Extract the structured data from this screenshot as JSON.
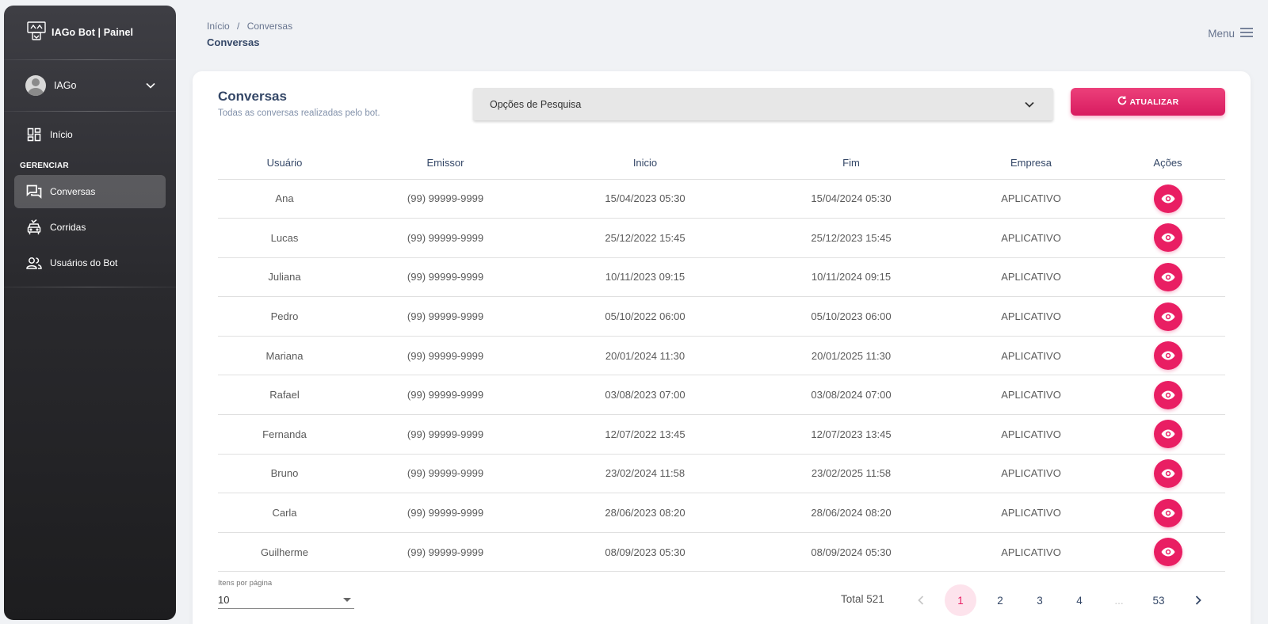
{
  "sidebar": {
    "brand": "IAGo Bot | Painel",
    "user": "IAGo",
    "section_label": "GERENCIAR",
    "items": [
      {
        "label": "Início",
        "icon": "dashboard-icon"
      },
      {
        "label": "Conversas",
        "icon": "chat-icon",
        "active": true
      },
      {
        "label": "Corridas",
        "icon": "car-icon"
      },
      {
        "label": "Usuários do Bot",
        "icon": "users-icon"
      }
    ]
  },
  "header": {
    "breadcrumb_home": "Início",
    "breadcrumb_sep": "/",
    "breadcrumb_current": "Conversas",
    "page_title": "Conversas",
    "menu_label": "Menu"
  },
  "card": {
    "title": "Conversas",
    "subtitle": "Todas as conversas realizadas pelo bot.",
    "search_label": "Opções de Pesquisa",
    "refresh_label": "ATUALIZAR"
  },
  "table": {
    "columns": [
      "Usuário",
      "Emissor",
      "Inicio",
      "Fim",
      "Empresa",
      "Ações"
    ],
    "rows": [
      [
        "Ana",
        "(99) 99999-9999",
        "15/04/2023 05:30",
        "15/04/2024 05:30",
        "APLICATIVO"
      ],
      [
        "Lucas",
        "(99) 99999-9999",
        "25/12/2022 15:45",
        "25/12/2023 15:45",
        "APLICATIVO"
      ],
      [
        "Juliana",
        "(99) 99999-9999",
        "10/11/2023 09:15",
        "10/11/2024 09:15",
        "APLICATIVO"
      ],
      [
        "Pedro",
        "(99) 99999-9999",
        "05/10/2022 06:00",
        "05/10/2023 06:00",
        "APLICATIVO"
      ],
      [
        "Mariana",
        "(99) 99999-9999",
        "20/01/2024 11:30",
        "20/01/2025 11:30",
        "APLICATIVO"
      ],
      [
        "Rafael",
        "(99) 99999-9999",
        "03/08/2023 07:00",
        "03/08/2024 07:00",
        "APLICATIVO"
      ],
      [
        "Fernanda",
        "(99) 99999-9999",
        "12/07/2022 13:45",
        "12/07/2023 13:45",
        "APLICATIVO"
      ],
      [
        "Bruno",
        "(99) 99999-9999",
        "23/02/2024 11:58",
        "23/02/2025 11:58",
        "APLICATIVO"
      ],
      [
        "Carla",
        "(99) 99999-9999",
        "28/06/2023 08:20",
        "28/06/2024 08:20",
        "APLICATIVO"
      ],
      [
        "Guilherme",
        "(99) 99999-9999",
        "08/09/2023 05:30",
        "08/09/2024 05:30",
        "APLICATIVO"
      ]
    ]
  },
  "footer": {
    "items_per_page_label": "Itens por página",
    "items_per_page_value": "10",
    "total": "Total 521",
    "pages": [
      "1",
      "2",
      "3",
      "4",
      "...",
      "53"
    ],
    "current_page": "1"
  },
  "colors": {
    "accent": "#e91e63",
    "sidebar_bg": "#2a2a2e",
    "background": "#f0f2f5"
  }
}
